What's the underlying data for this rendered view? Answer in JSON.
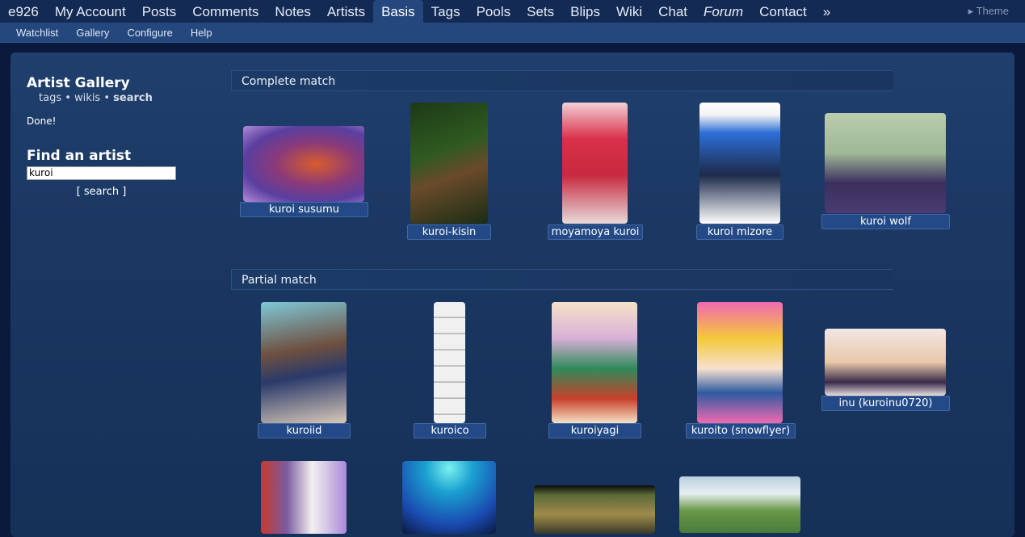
{
  "topnav": {
    "items": [
      "e926",
      "My Account",
      "Posts",
      "Comments",
      "Notes",
      "Artists",
      "Basis",
      "Tags",
      "Pools",
      "Sets",
      "Blips",
      "Wiki",
      "Chat",
      "Forum",
      "Contact",
      "»"
    ],
    "active": "Basis",
    "theme": "▸ Theme"
  },
  "subnav": {
    "items": [
      "Watchlist",
      "Gallery",
      "Configure",
      "Help"
    ]
  },
  "sidebar": {
    "title": "Artist Gallery",
    "links": {
      "tags": "tags",
      "wikis": "wikis",
      "search": "search",
      "sep": "•"
    },
    "status": "Done!",
    "find_title": "Find an artist",
    "search_value": "kuroi",
    "search_button": "[ search ]"
  },
  "sections": {
    "complete": "Complete match",
    "partial": "Partial match"
  },
  "complete_items": [
    {
      "label": "kuroi susumu"
    },
    {
      "label": "kuroi-kisin"
    },
    {
      "label": "moyamoya kuroi"
    },
    {
      "label": "kuroi mizore"
    },
    {
      "label": "kuroi wolf"
    }
  ],
  "partial_items": [
    {
      "label": "kuroiid"
    },
    {
      "label": "kuroico"
    },
    {
      "label": "kuroiyagi"
    },
    {
      "label": "kuroito (snowflyer)"
    },
    {
      "label": "inu (kuroinu0720)"
    }
  ],
  "colors": {
    "nav_bg": "#132a54",
    "subnav_bg": "#24477e",
    "panel": "#1a3762",
    "label_bg": "#234a86"
  }
}
